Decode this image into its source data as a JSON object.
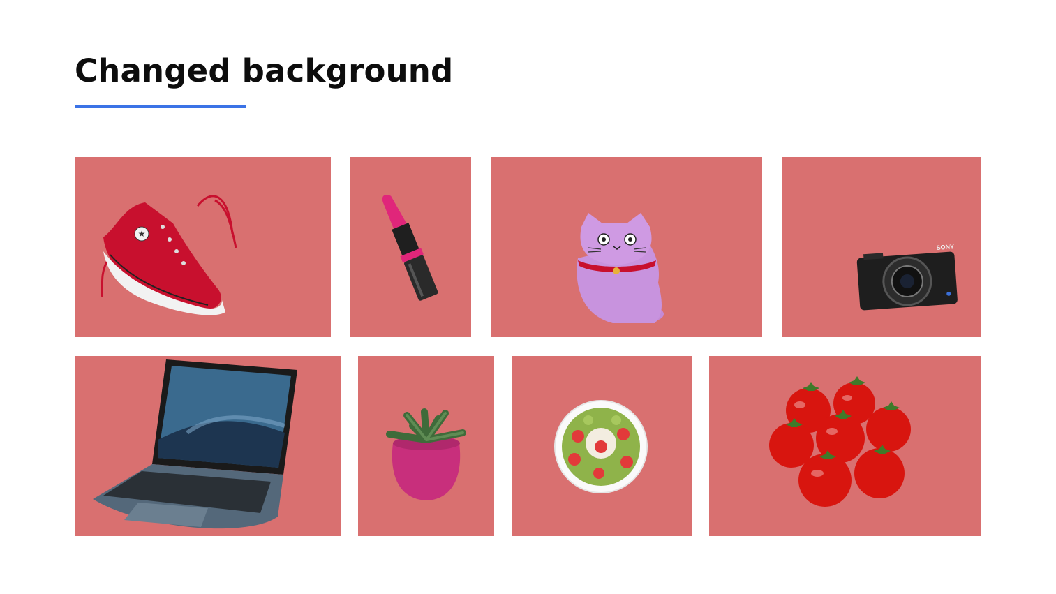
{
  "page": {
    "title": "Changed background",
    "accent_color": "#3b73e6",
    "tile_background": "#d97070"
  },
  "tiles": [
    {
      "name": "sneaker",
      "icon": "sneaker-icon"
    },
    {
      "name": "lipstick",
      "icon": "lipstick-icon"
    },
    {
      "name": "cat-plush",
      "icon": "cat-plush-icon"
    },
    {
      "name": "camera",
      "icon": "camera-icon"
    },
    {
      "name": "laptop",
      "icon": "laptop-icon"
    },
    {
      "name": "potted-plant",
      "icon": "potted-plant-icon"
    },
    {
      "name": "salad-bowl",
      "icon": "salad-bowl-icon"
    },
    {
      "name": "tomatoes",
      "icon": "tomatoes-icon"
    }
  ],
  "overlay_text": {
    "camera_brand": "SONY"
  }
}
